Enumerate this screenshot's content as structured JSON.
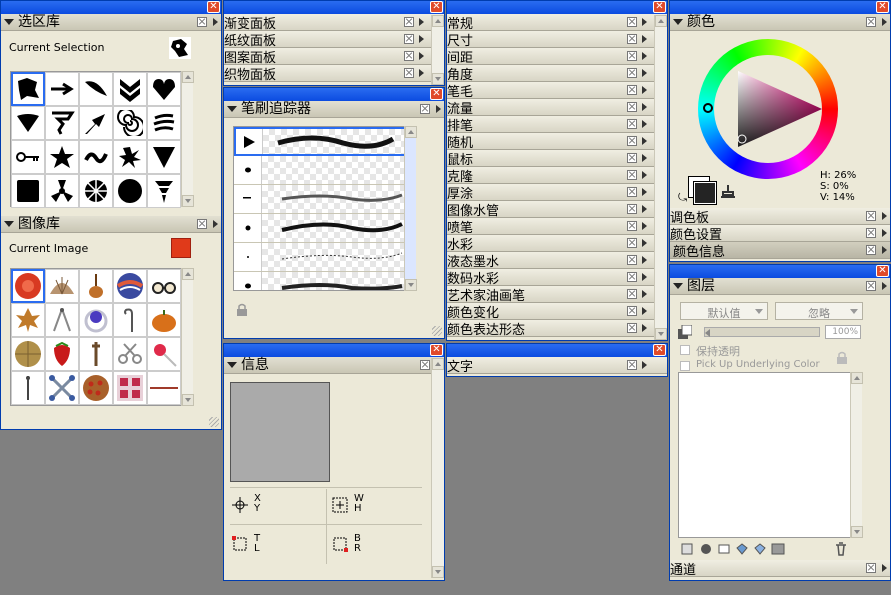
{
  "selection_panel": {
    "title": "选区库",
    "label": "Current Selection"
  },
  "image_panel": {
    "title": "图像库",
    "label": "Current Image"
  },
  "top_panels": [
    "渐变面板",
    "纸纹面板",
    "图案面板",
    "织物面板"
  ],
  "brush_tracker": {
    "title": "笔刷追踪器"
  },
  "info_panel": {
    "title": "信息",
    "x_label": "X",
    "y_label": "Y",
    "w_label": "W",
    "h_label": "H",
    "t_label": "T",
    "l_label": "L",
    "b_label": "B",
    "r_label": "R"
  },
  "brush_categories": [
    "常规",
    "尺寸",
    "间距",
    "角度",
    "笔毛",
    "流量",
    "排笔",
    "随机",
    "鼠标",
    "克隆",
    "厚涂",
    "图像水管",
    "喷笔",
    "水彩",
    "液态墨水",
    "数码水彩",
    "艺术家油画笔",
    "颜色变化",
    "颜色表达形态"
  ],
  "text_panel": {
    "title": "文字"
  },
  "color_panel": {
    "title": "颜色",
    "h": "H: 26%",
    "s": "S: 0%",
    "v": "V: 14%",
    "sub": [
      "调色板",
      "颜色设置",
      "颜色信息"
    ],
    "accent": "#2a6cf0"
  },
  "layers_panel": {
    "title": "图层",
    "composite": "默认值",
    "method": "忽略",
    "opacity": "100%",
    "preserve": "保持透明",
    "pickup": "Pick Up Underlying Color",
    "channels": "通道"
  }
}
